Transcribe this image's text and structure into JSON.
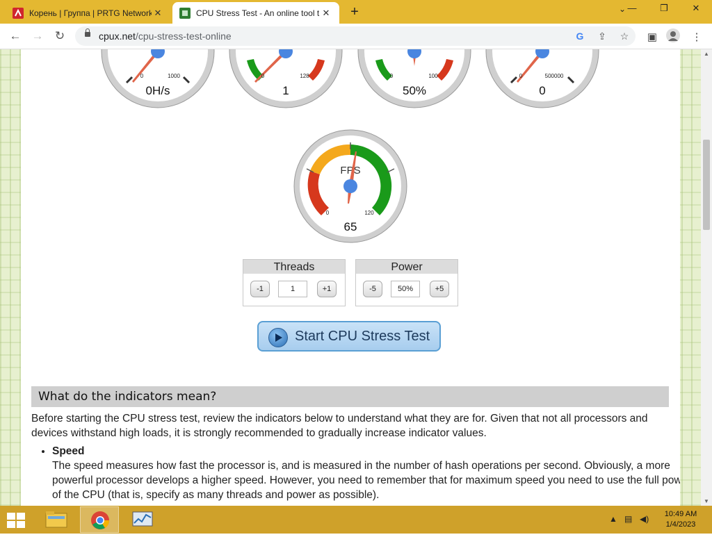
{
  "browser": {
    "tabs": [
      {
        "title": "Корень | Группа | PRTG Network",
        "active": false
      },
      {
        "title": "CPU Stress Test - An online tool t",
        "active": true
      }
    ],
    "url_host": "cpux.net",
    "url_path": "/cpu-stress-test-online"
  },
  "gauges_top": [
    {
      "value_label": "0H/s",
      "min_label": "0",
      "max_label": "1000"
    },
    {
      "value_label": "1",
      "min_label": "0",
      "max_label": "128"
    },
    {
      "value_label": "50%",
      "min_label": "0",
      "max_label": "100"
    },
    {
      "value_label": "0",
      "min_label": "0",
      "max_label": "500000"
    }
  ],
  "fps_gauge": {
    "title": "FPS",
    "value_label": "65",
    "min_label": "0",
    "max_label": "120",
    "value": 65
  },
  "controls": {
    "threads": {
      "title": "Threads",
      "minus": "-1",
      "value": "1",
      "plus": "+1"
    },
    "power": {
      "title": "Power",
      "minus": "-5",
      "value": "50%",
      "plus": "+5"
    }
  },
  "start_button": "Start CPU Stress Test",
  "section": {
    "heading": "What do the indicators mean?",
    "intro": "Before starting the CPU stress test, review the indicators below to understand what they are for. Given that not all processors and devices withstand high loads, it is strongly recommended to gradually increase indicator values.",
    "items": [
      {
        "title": "Speed",
        "text": "The speed measures how fast the processor is, and is measured in the number of hash operations per second. Obviously, a more powerful processor develops a higher speed. However, you need to remember that for maximum speed you need to use the full power of the CPU (that is, specify as many threads and power as possible)."
      }
    ]
  },
  "taskbar": {
    "time": "10:49 AM",
    "date": "1/4/2023"
  },
  "colors": {
    "tab_bar": "#e4b831",
    "taskbar": "#cfa12a",
    "gauge_green": "#1a9a1a",
    "gauge_red": "#d6381d",
    "gauge_orange": "#f4a81c",
    "needle": "#e0654a",
    "hub": "#4a86e0"
  }
}
